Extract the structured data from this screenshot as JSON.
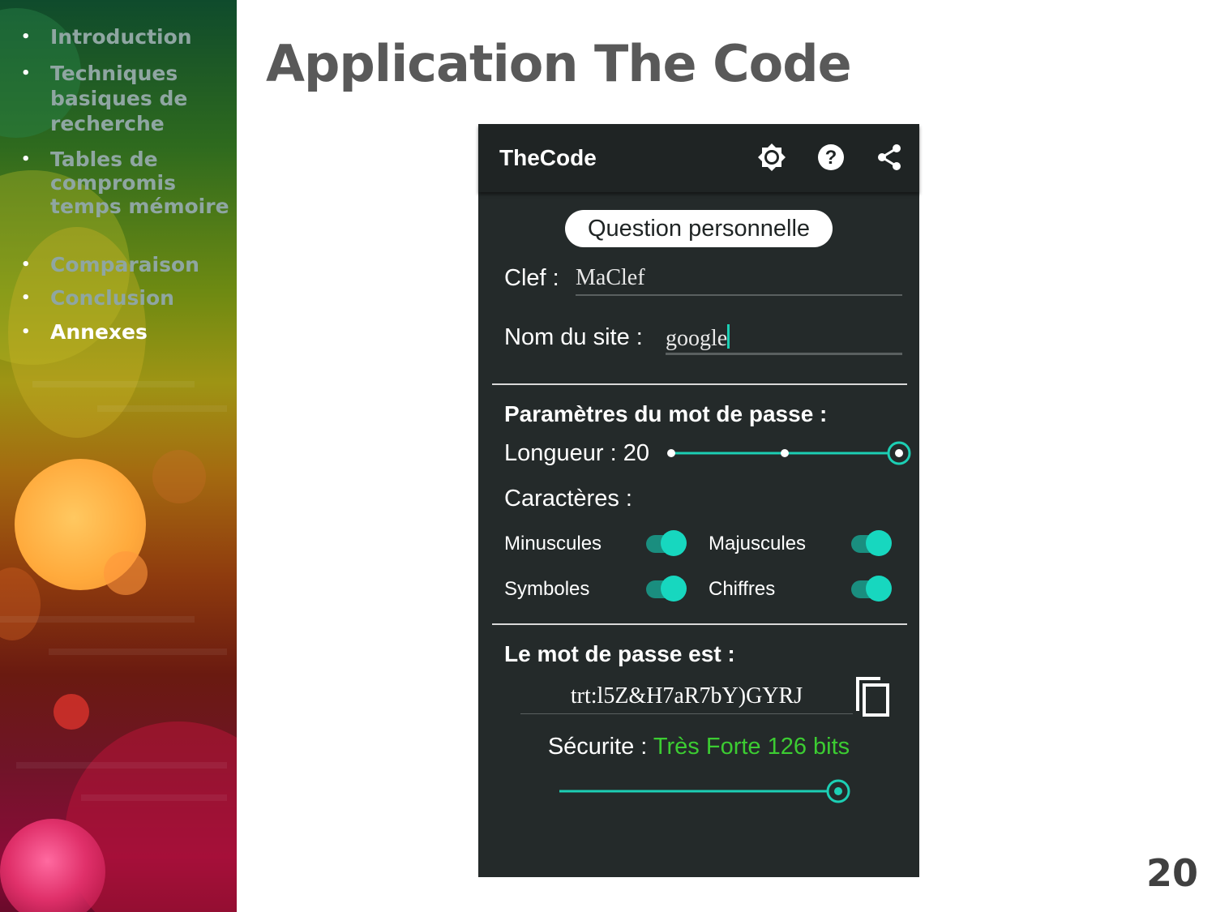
{
  "sidebar": {
    "items": [
      {
        "label": "Introduction"
      },
      {
        "label": "Techniques basiques de recherche"
      },
      {
        "label": "Tables de compromis temps mémoire"
      },
      {
        "label": "Comparaison"
      },
      {
        "label": "Conclusion"
      },
      {
        "label": "Annexes",
        "active": true
      }
    ]
  },
  "slide": {
    "title": "Application The Code",
    "page_number": "20"
  },
  "app": {
    "name": "TheCode",
    "toolbar_icons": [
      "brightness-icon",
      "help-icon",
      "share-icon"
    ],
    "mode_button": "Question personnelle",
    "key_label": "Clef :",
    "key_value": "MaClef",
    "site_label": "Nom du site :",
    "site_value": "google",
    "params_heading": "Paramètres du mot de passe :",
    "length_label": "Longueur : 20",
    "length_value": 20,
    "length_slider_fraction": 1.0,
    "chars_label": "Caractères :",
    "toggles": [
      {
        "label": "Minuscules",
        "on": true
      },
      {
        "label": "Majuscules",
        "on": true
      },
      {
        "label": "Symboles",
        "on": true
      },
      {
        "label": "Chiffres",
        "on": true
      }
    ],
    "result_heading": "Le mot de passe est :",
    "password": "trt:l5Z&H7aR7bY)GYRJ",
    "security_label": "Sécurite :",
    "security_value": "Très Forte 126 bits",
    "security_fraction": 1.0,
    "colors": {
      "background": "#242a2a",
      "accent": "#17d7bf",
      "strength": "#3ccc32"
    }
  }
}
